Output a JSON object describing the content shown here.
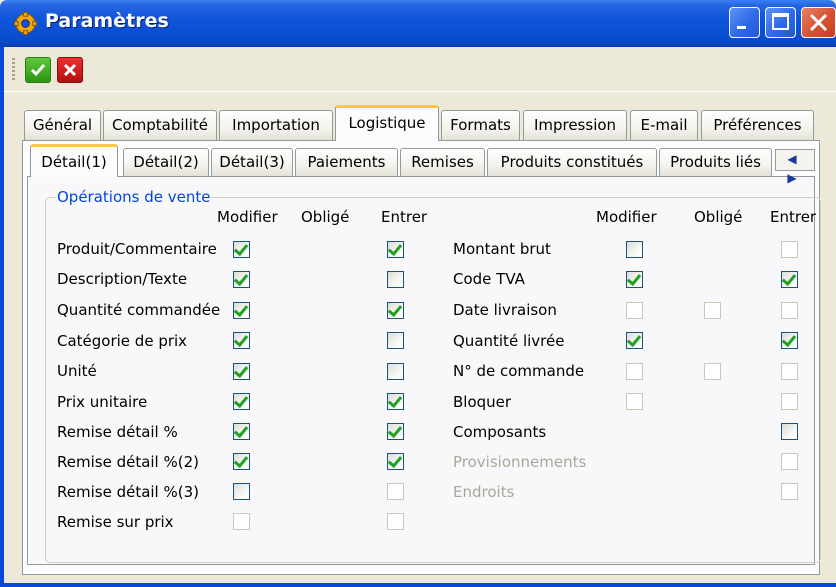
{
  "window": {
    "title": "Paramètres"
  },
  "toolbar": {
    "ok_tooltip": "",
    "cancel_tooltip": ""
  },
  "tabs": [
    "Général",
    "Comptabilité",
    "Importation",
    "Logistique",
    "Formats",
    "Impression",
    "E-mail",
    "Préférences"
  ],
  "active_tab": "Logistique",
  "subtabs": [
    "Détail(1)",
    "Détail(2)",
    "Détail(3)",
    "Paiements",
    "Remises",
    "Produits constitués",
    "Produits liés"
  ],
  "active_subtab": "Détail(1)",
  "subtab_scroll": "◀ ▶",
  "group": {
    "title": "Opérations de vente",
    "headers": {
      "modifier": "Modifier",
      "oblige": "Obligé",
      "entrer": "Entrer"
    },
    "left_rows": [
      {
        "label": "Produit/Commentaire",
        "modifier": true,
        "entrer": true
      },
      {
        "label": "Description/Texte",
        "modifier": true,
        "entrer": false
      },
      {
        "label": "Quantité commandée",
        "modifier": true,
        "entrer": true
      },
      {
        "label": "Catégorie de prix",
        "modifier": true,
        "entrer": false
      },
      {
        "label": "Unité",
        "modifier": true,
        "entrer": false
      },
      {
        "label": "Prix unitaire",
        "modifier": true,
        "entrer": true
      },
      {
        "label": "Remise détail %",
        "modifier": true,
        "entrer": true
      },
      {
        "label": "Remise détail %(2)",
        "modifier": true,
        "entrer": true
      },
      {
        "label": "Remise détail %(3)",
        "modifier": false,
        "entrer": false
      },
      {
        "label": "Remise sur prix",
        "modifier": false,
        "entrer": false
      }
    ],
    "right_rows": [
      {
        "label": "Montant brut",
        "modifier": false,
        "oblige": null,
        "entrer": false
      },
      {
        "label": "Code TVA",
        "modifier": true,
        "oblige": null,
        "entrer": true
      },
      {
        "label": "Date livraison",
        "modifier": false,
        "oblige": false,
        "entrer": false
      },
      {
        "label": "Quantité livrée",
        "modifier": true,
        "oblige": null,
        "entrer": true
      },
      {
        "label": "N° de commande",
        "modifier": false,
        "oblige": false,
        "entrer": false
      },
      {
        "label": "Bloquer",
        "modifier": false,
        "oblige": null,
        "entrer": false
      },
      {
        "label": "Composants",
        "modifier": null,
        "oblige": null,
        "entrer": false
      },
      {
        "label": "Provisionnements",
        "modifier": null,
        "oblige": null,
        "entrer": false
      },
      {
        "label": "Endroits",
        "modifier": null,
        "oblige": null,
        "entrer": false
      }
    ]
  },
  "icons": {
    "title": "gear-icon",
    "ok": "checkmark-icon",
    "cancel": "cross-icon",
    "minimize": "minimize-icon",
    "maximize": "maximize-icon",
    "close": "close-icon"
  }
}
